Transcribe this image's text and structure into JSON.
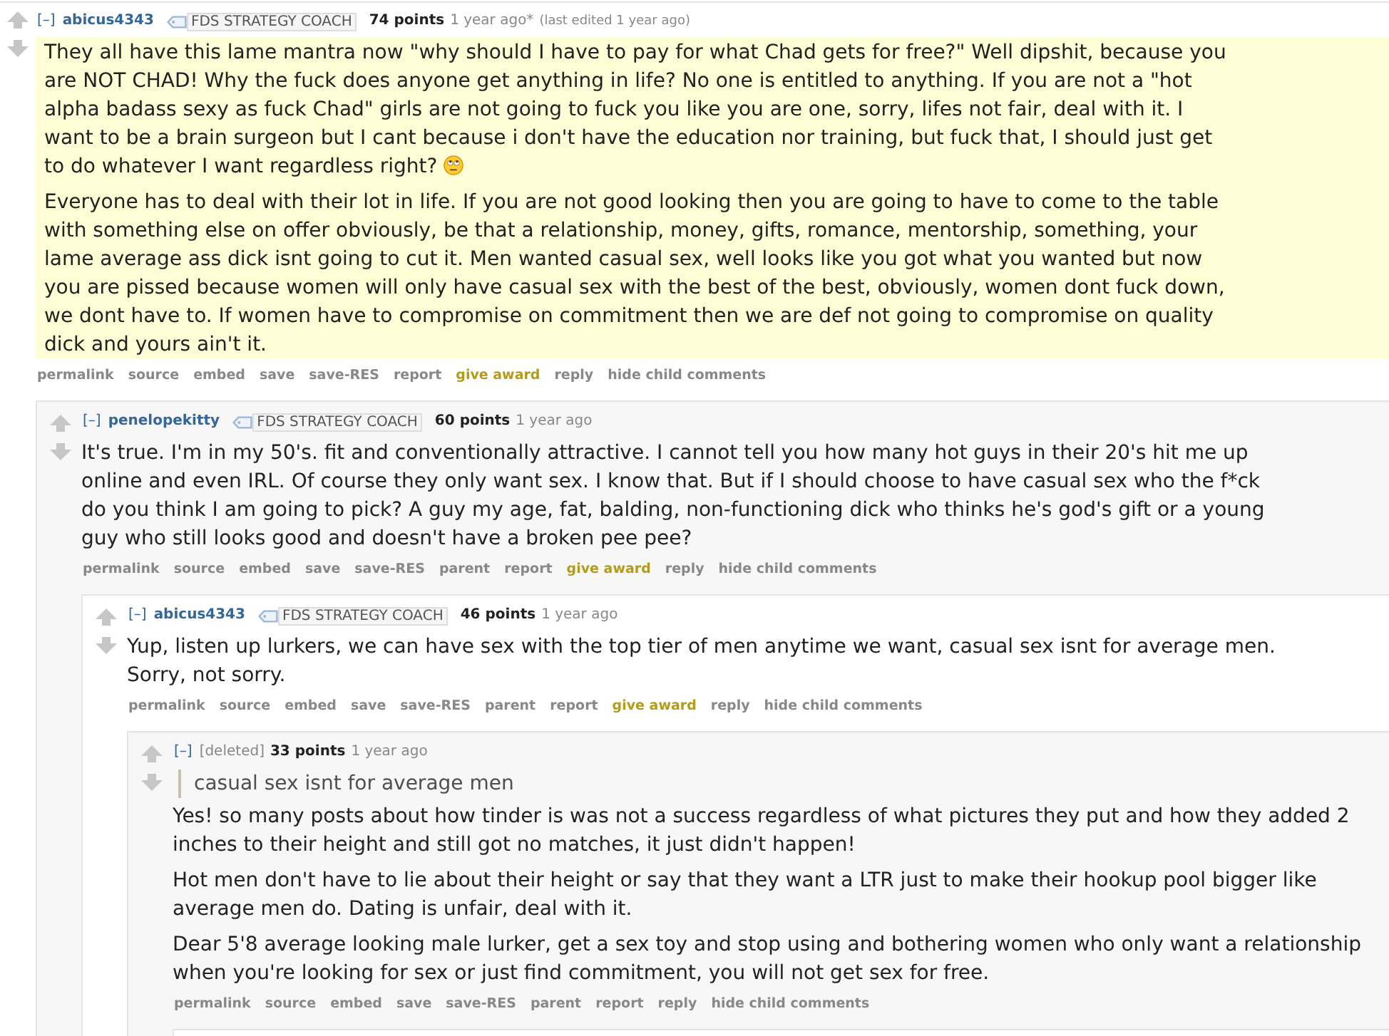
{
  "comments": [
    {
      "expand": "[–]",
      "author": "abicus4343",
      "deleted": false,
      "flair": "FDS STRATEGY COACH",
      "points": "74 points",
      "time": "1 year ago*",
      "edited": "(last edited 1 year ago)",
      "highlighted": true,
      "body": [
        {
          "kind": "paragraph",
          "text": "They all have this lame mantra now \"why should I have to pay for what Chad gets for free?\" Well dipshit, because you are NOT CHAD! Why the fuck does anyone get anything in life? No one is entitled to anything. If you are not a \"hot alpha badass sexy as fuck Chad\" girls are not going to fuck you like you are one, sorry, lifes not fair, deal with it. I want to be a brain surgeon but I cant because i don't have the education nor training, but fuck that, I should just get to do whatever I want regardless right?",
          "emoji": true
        },
        {
          "kind": "paragraph",
          "text": "Everyone has to deal with their lot in life. If you are not good looking then you are going to have to come to the table with something else on offer obviously, be that a relationship, money, gifts, romance, mentorship, something, your lame average ass dick isnt going to cut it. Men wanted casual sex, well looks like you got what you wanted but now you are pissed because women will only have casual sex with the best of the best, obviously, women dont fuck down, we dont have to. If women have to compromise on commitment then we are def not going to compromise on quality dick and yours ain't it.",
          "emoji": false
        }
      ],
      "actions": [
        {
          "label": "permalink",
          "kind": "link"
        },
        {
          "label": "source",
          "kind": "link"
        },
        {
          "label": "embed",
          "kind": "link"
        },
        {
          "label": "save",
          "kind": "link"
        },
        {
          "label": "save-RES",
          "kind": "link"
        },
        {
          "label": "report",
          "kind": "link"
        },
        {
          "label": "give award",
          "kind": "award"
        },
        {
          "label": "reply",
          "kind": "link"
        },
        {
          "label": "hide child comments",
          "kind": "link"
        }
      ],
      "children": [
        {
          "expand": "[–]",
          "author": "penelopekitty",
          "deleted": false,
          "flair": "FDS STRATEGY COACH",
          "points": "60 points",
          "time": "1 year ago",
          "highlighted": false,
          "body": [
            {
              "kind": "paragraph",
              "text": "It's true. I'm in my 50's. fit and conventionally attractive. I cannot tell you how many hot guys in their 20's hit me up online and even IRL. Of course they only want sex. I know that. But if I should choose to have casual sex who the f*ck do you think I am going to pick? A guy my age, fat, balding, non-functioning dick who thinks he's god's gift or a young guy who still looks good and doesn't have a broken pee pee?",
              "emoji": false
            }
          ],
          "actions": [
            {
              "label": "permalink",
              "kind": "link"
            },
            {
              "label": "source",
              "kind": "link"
            },
            {
              "label": "embed",
              "kind": "link"
            },
            {
              "label": "save",
              "kind": "link"
            },
            {
              "label": "save-RES",
              "kind": "link"
            },
            {
              "label": "parent",
              "kind": "link"
            },
            {
              "label": "report",
              "kind": "link"
            },
            {
              "label": "give award",
              "kind": "award"
            },
            {
              "label": "reply",
              "kind": "link"
            },
            {
              "label": "hide child comments",
              "kind": "link"
            }
          ],
          "children": [
            {
              "expand": "[–]",
              "author": "abicus4343",
              "deleted": false,
              "flair": "FDS STRATEGY COACH",
              "points": "46 points",
              "time": "1 year ago",
              "highlighted": false,
              "body": [
                {
                  "kind": "paragraph",
                  "text": "Yup, listen up lurkers, we can have sex with the top tier of men anytime we want, casual sex isnt for average men. Sorry, not sorry.",
                  "emoji": false
                }
              ],
              "actions": [
                {
                  "label": "permalink",
                  "kind": "link"
                },
                {
                  "label": "source",
                  "kind": "link"
                },
                {
                  "label": "embed",
                  "kind": "link"
                },
                {
                  "label": "save",
                  "kind": "link"
                },
                {
                  "label": "save-RES",
                  "kind": "link"
                },
                {
                  "label": "parent",
                  "kind": "link"
                },
                {
                  "label": "report",
                  "kind": "link"
                },
                {
                  "label": "give award",
                  "kind": "award"
                },
                {
                  "label": "reply",
                  "kind": "link"
                },
                {
                  "label": "hide child comments",
                  "kind": "link"
                }
              ],
              "children": [
                {
                  "expand": "[–]",
                  "author": "[deleted]",
                  "deleted": true,
                  "points": "33 points",
                  "time": "1 year ago",
                  "highlighted": false,
                  "child_cut_off": true,
                  "body": [
                    {
                      "kind": "quote",
                      "text": "casual sex isnt for average men"
                    },
                    {
                      "kind": "paragraph",
                      "text": "Yes! so many posts about how tinder is was not a success regardless of what pictures they put and how they added 2 inches to their height and still got no matches, it just didn't happen!",
                      "emoji": false
                    },
                    {
                      "kind": "paragraph",
                      "text": "Hot men don't have to lie about their height or say that they want a LTR just to make their hookup pool bigger like average men do. Dating is unfair, deal with it.",
                      "emoji": false
                    },
                    {
                      "kind": "paragraph",
                      "text": "Dear 5'8 average looking male lurker, get a sex toy and stop using and bothering women who only want a relationship when you're looking for sex or just find commitment, you will not get sex for free.",
                      "emoji": false
                    }
                  ],
                  "actions": [
                    {
                      "label": "permalink",
                      "kind": "link"
                    },
                    {
                      "label": "source",
                      "kind": "link"
                    },
                    {
                      "label": "embed",
                      "kind": "link"
                    },
                    {
                      "label": "save",
                      "kind": "link"
                    },
                    {
                      "label": "save-RES",
                      "kind": "link"
                    },
                    {
                      "label": "parent",
                      "kind": "link"
                    },
                    {
                      "label": "report",
                      "kind": "link"
                    },
                    {
                      "label": "reply",
                      "kind": "link"
                    },
                    {
                      "label": "hide child comments",
                      "kind": "link"
                    }
                  ]
                }
              ]
            }
          ]
        }
      ]
    }
  ]
}
